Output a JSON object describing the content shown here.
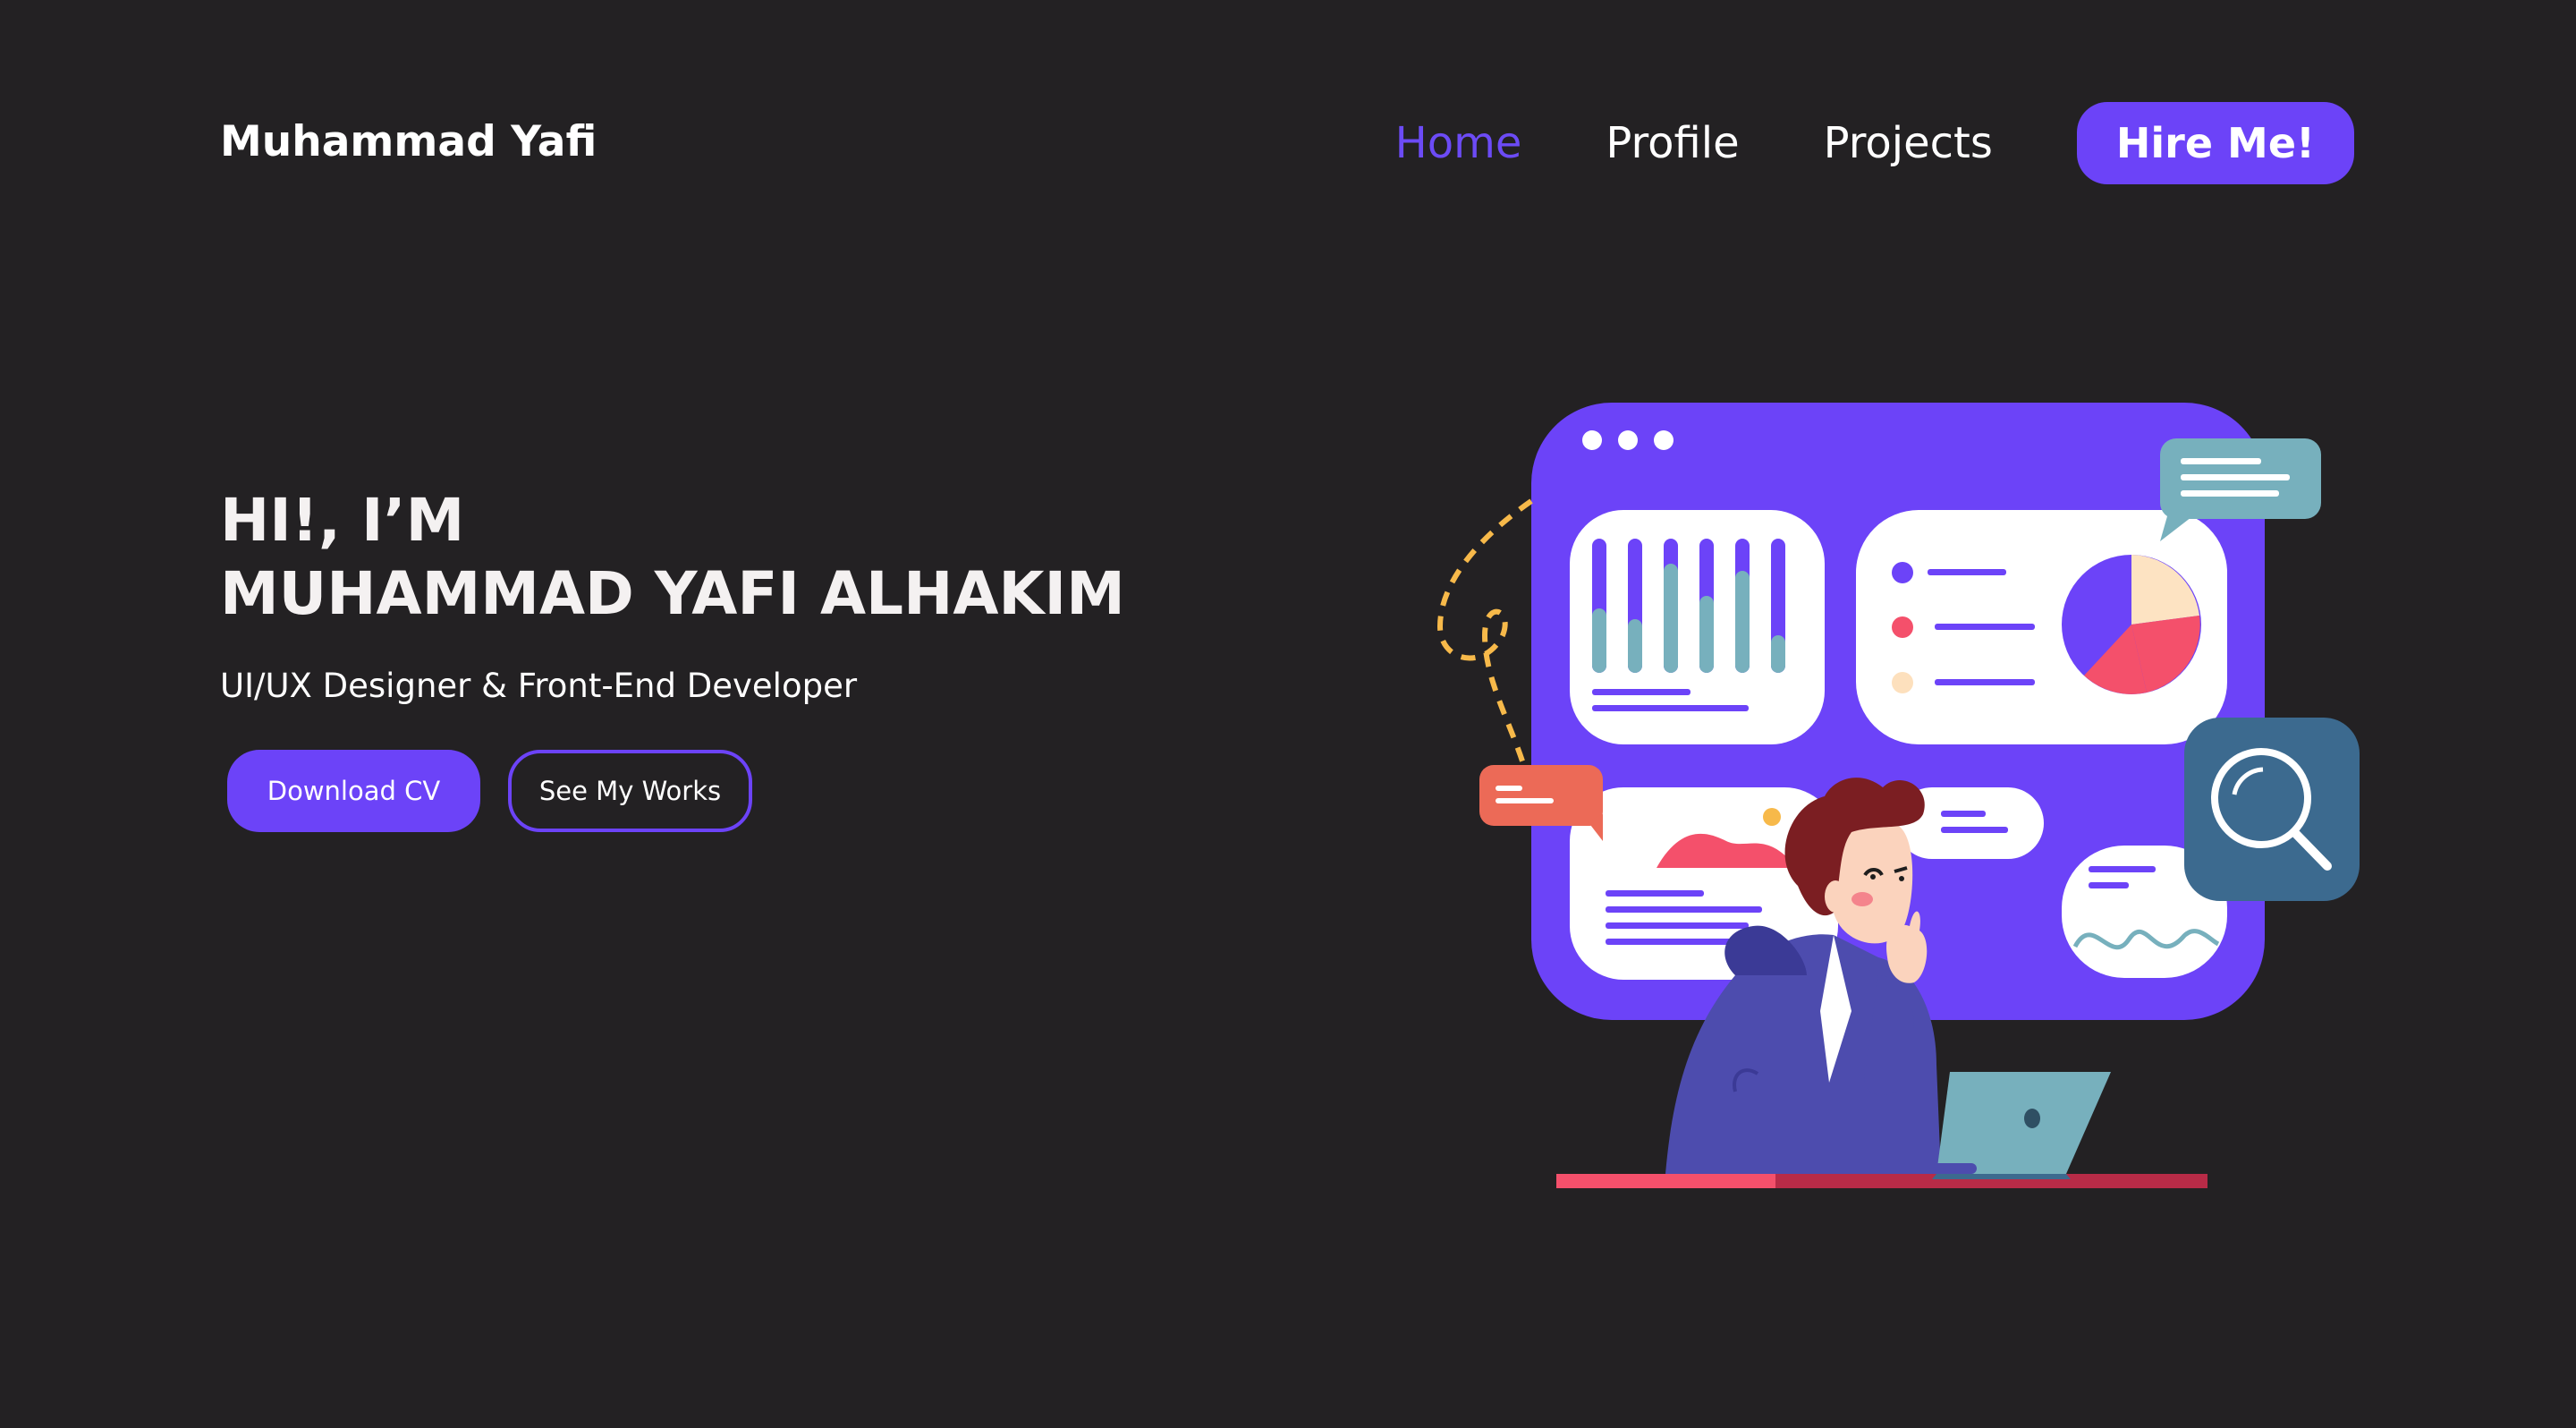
{
  "header": {
    "brand": "Muhammad Yafi",
    "nav": [
      {
        "label": "Home",
        "active": true
      },
      {
        "label": "Profile",
        "active": false
      },
      {
        "label": "Projects",
        "active": false
      }
    ],
    "cta_label": "Hire Me!"
  },
  "hero": {
    "greeting": "HI!, I’M",
    "name": "MUHAMMAD YAFI ALHAKIM",
    "role": "UI/UX Designer & Front-End Developer",
    "primary_button": "Download CV",
    "secondary_button": "See My Works"
  },
  "colors": {
    "background": "#232123",
    "accent": "#6c43f8",
    "active_nav": "#6c4bf6",
    "text": "#ffffff"
  },
  "illustration": {
    "icons": [
      "dashboard-window-icon",
      "bar-chart-icon",
      "pie-chart-icon",
      "chat-bubble-icon",
      "magnifier-icon",
      "person-thinking-icon",
      "laptop-icon"
    ]
  }
}
